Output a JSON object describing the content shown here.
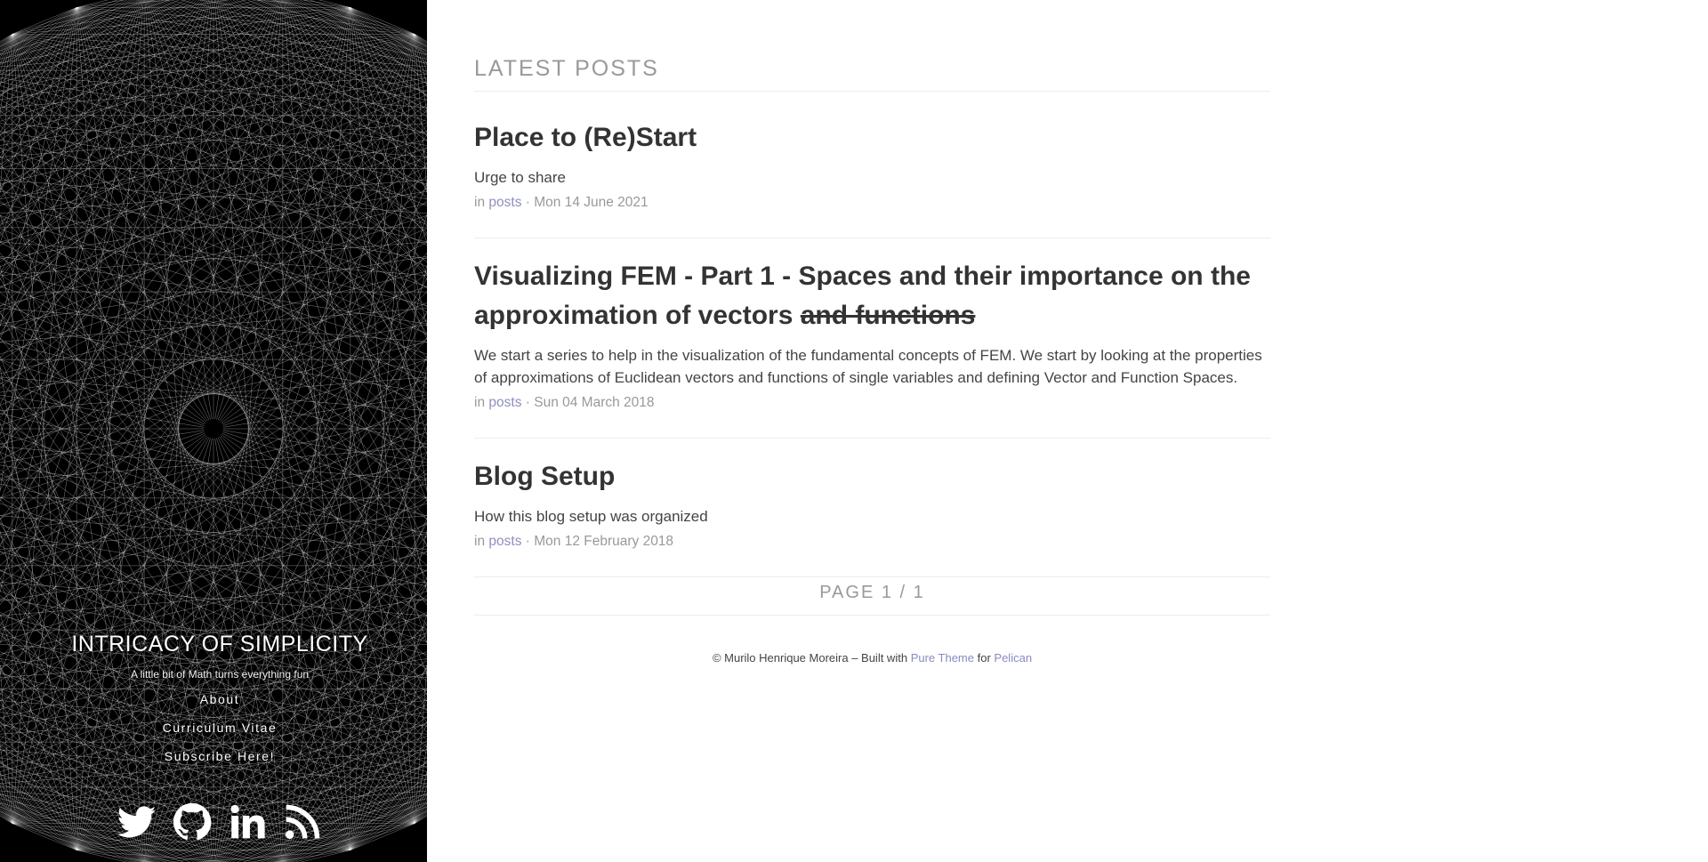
{
  "sidebar": {
    "brand_title": "Intricacy of Simplicity",
    "tagline": "A little bit of Math turns everything fun",
    "nav": [
      {
        "label": "About"
      },
      {
        "label": "Curriculum Vitae"
      },
      {
        "label": "Subscribe Here!"
      }
    ],
    "social_icons": [
      "twitter-icon",
      "github-icon",
      "linkedin-icon",
      "rss-icon"
    ]
  },
  "main": {
    "section_title": "Latest Posts",
    "posts": [
      {
        "title": "Place to (Re)Start",
        "title_struck": "",
        "summary": "Urge to share",
        "meta_prefix": "in",
        "category": "posts",
        "date": "· Mon 14 June 2021"
      },
      {
        "title": "Visualizing FEM - Part 1 - Spaces and their importance on the approximation of vectors",
        "title_struck": "and functions",
        "summary": "We start a series to help in the visualization of the fundamental concepts of FEM. We start by looking at the properties of approximations of Euclidean vectors and functions of single variables and defining Vector and Function Spaces.",
        "meta_prefix": "in",
        "category": "posts",
        "date": "· Sun 04 March 2018"
      },
      {
        "title": "Blog Setup",
        "title_struck": "",
        "summary": "How this blog setup was organized",
        "meta_prefix": "in",
        "category": "posts",
        "date": "· Mon 12 February 2018"
      }
    ],
    "pagination": "Page 1 / 1"
  },
  "footer": {
    "prefix": "© Murilo Henrique Moreira – Built with",
    "theme_link": "Pure Theme",
    "connector": "for",
    "engine_link": "Pelican"
  },
  "colors": {
    "link": "#8f8fbf",
    "title": "#333333",
    "muted": "#999999",
    "sidebar_bg": "#000000"
  }
}
